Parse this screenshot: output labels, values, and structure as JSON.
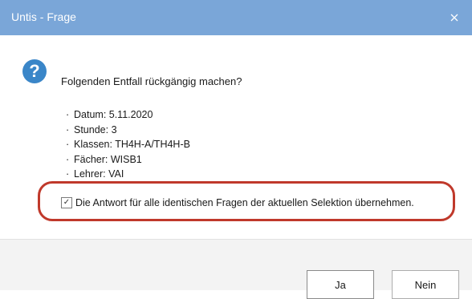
{
  "window": {
    "title": "Untis - Frage",
    "close_icon": "close-icon"
  },
  "dialog": {
    "icon": "question-icon",
    "icon_glyph": "?",
    "question": "Folgenden Entfall rückgängig machen?",
    "details": [
      "Datum: 5.11.2020",
      "Stunde: 3",
      "Klassen: TH4H-A/TH4H-B",
      "Fächer: WISB1",
      "Lehrer: VAI"
    ],
    "checkbox": {
      "checked": true,
      "label": "Die Antwort für alle identischen Fragen der aktuellen Selektion übernehmen."
    }
  },
  "buttons": {
    "yes": "Ja",
    "no": "Nein"
  },
  "colors": {
    "titlebar": "#7aa6d8",
    "highlight": "#c0392b",
    "icon": "#3a86c8"
  }
}
